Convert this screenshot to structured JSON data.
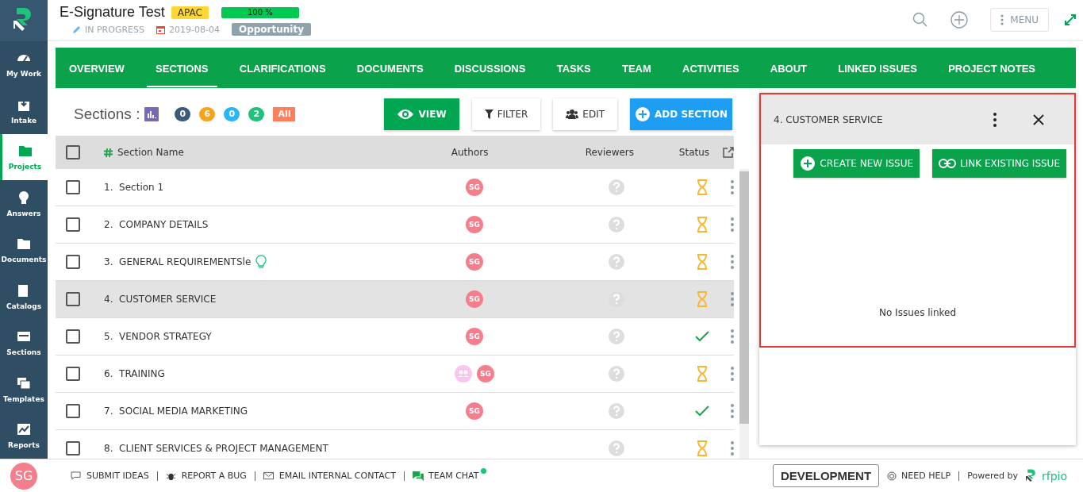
{
  "sidebar": {
    "items": [
      {
        "label": "My Work",
        "selected": false
      },
      {
        "label": "Intake",
        "selected": false
      },
      {
        "label": "Projects",
        "selected": true
      },
      {
        "label": "Answers",
        "selected": false
      },
      {
        "label": "Documents",
        "selected": false
      },
      {
        "label": "Catalogs",
        "selected": false
      },
      {
        "label": "Sections",
        "selected": false
      },
      {
        "label": "Templates",
        "selected": false
      },
      {
        "label": "Reports",
        "selected": false
      }
    ]
  },
  "header": {
    "title": "E-Signature Test",
    "region": "APAC",
    "progress_label": "100 %",
    "level": 1,
    "status": "IN PROGRESS",
    "date": "2019-08-04",
    "type": "Opportunity",
    "menu": "MENU"
  },
  "tabs": [
    {
      "label": "OVERVIEW",
      "selected": false
    },
    {
      "label": "SECTIONS",
      "selected": true
    },
    {
      "label": "CLARIFICATIONS",
      "selected": false
    },
    {
      "label": "DOCUMENTS",
      "selected": false
    },
    {
      "label": "DISCUSSIONS",
      "selected": false
    },
    {
      "label": "TASKS",
      "selected": false
    },
    {
      "label": "TEAM",
      "selected": false
    },
    {
      "label": "ACTIVITIES",
      "selected": false
    },
    {
      "label": "ABOUT",
      "selected": false
    },
    {
      "label": "LINKED ISSUES",
      "selected": false
    },
    {
      "label": "PROJECT NOTES",
      "selected": false
    }
  ],
  "sections": {
    "title": "Sections :",
    "counts": [
      {
        "label": "0",
        "color": "#3d5a78"
      },
      {
        "label": "6",
        "color": "#f7a21b"
      },
      {
        "label": "0",
        "color": "#29b6f6"
      },
      {
        "label": "2",
        "color": "#1ec27a"
      },
      {
        "label": "All",
        "color": "#ff7f5c"
      }
    ],
    "buttons": [
      {
        "label": "VIEW",
        "kind": "view"
      },
      {
        "label": "FILTER",
        "kind": "filter"
      },
      {
        "label": "EDIT",
        "kind": "edit"
      },
      {
        "label": "ADD SECTION",
        "kind": "add"
      }
    ],
    "select_all_checked": false,
    "columns": [
      "Section Name",
      "Authors",
      "Reviewers",
      "Status"
    ],
    "rows": [
      {
        "number": "1.",
        "name": "Section 1",
        "checked": false,
        "authors": [
          "SG"
        ],
        "group_author": false,
        "hint": false,
        "complete": false,
        "selected": false
      },
      {
        "number": "2.",
        "name": "COMPANY DETAILS",
        "checked": false,
        "authors": [
          "SG"
        ],
        "group_author": false,
        "hint": false,
        "complete": false,
        "selected": false
      },
      {
        "number": "3.",
        "name": "GENERAL REQUIREMENTSle",
        "checked": false,
        "authors": [
          "SG"
        ],
        "group_author": false,
        "hint": true,
        "complete": false,
        "selected": false
      },
      {
        "number": "4.",
        "name": "CUSTOMER SERVICE",
        "checked": false,
        "authors": [
          "SG"
        ],
        "group_author": false,
        "hint": false,
        "complete": false,
        "selected": true
      },
      {
        "number": "5.",
        "name": "VENDOR STRATEGY",
        "checked": false,
        "authors": [
          "SG"
        ],
        "group_author": false,
        "hint": false,
        "complete": true,
        "selected": false
      },
      {
        "number": "6.",
        "name": "TRAINING",
        "checked": false,
        "authors": [
          "SG"
        ],
        "group_author": true,
        "hint": false,
        "complete": false,
        "selected": false
      },
      {
        "number": "7.",
        "name": "SOCIAL MEDIA MARKETING",
        "checked": false,
        "authors": [
          "SG"
        ],
        "group_author": false,
        "hint": false,
        "complete": true,
        "selected": false
      },
      {
        "number": "8.",
        "name": "CLIENT SERVICES & PROJECT MANAGEMENT",
        "checked": false,
        "authors": [],
        "group_author": false,
        "hint": false,
        "complete": false,
        "selected": false
      }
    ]
  },
  "panel": {
    "title": "4. CUSTOMER SERVICE",
    "create": "CREATE NEW ISSUE",
    "link": "LINK EXISTING ISSUE",
    "empty": "No Issues linked"
  },
  "footer": {
    "avatar": "SG",
    "links": [
      {
        "label": "SUBMIT IDEAS"
      },
      {
        "label": "REPORT A BUG"
      },
      {
        "label": "EMAIL INTERNAL CONTACT"
      },
      {
        "label": "TEAM CHAT",
        "online": true
      }
    ],
    "environment": "DEVELOPMENT",
    "help": "NEED HELP",
    "powered": "Powered by",
    "brand": "rfpio"
  }
}
